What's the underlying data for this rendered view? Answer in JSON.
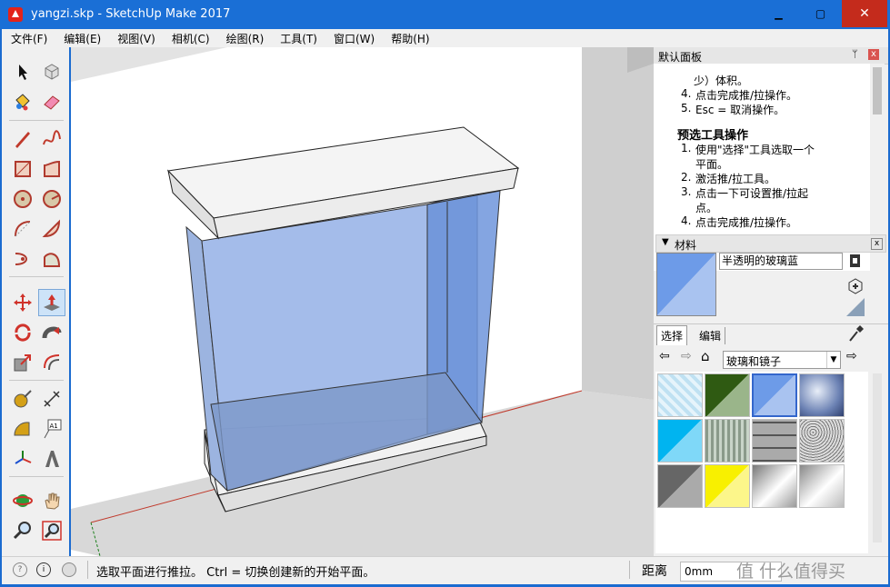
{
  "window": {
    "title": "yangzi.skp - SketchUp Make 2017",
    "min_glyph": "▁",
    "max_glyph": "▢",
    "close_glyph": "✕"
  },
  "menu": [
    "文件(F)",
    "编辑(E)",
    "视图(V)",
    "相机(C)",
    "绘图(R)",
    "工具(T)",
    "窗口(W)",
    "帮助(H)"
  ],
  "tools": [
    "select-icon",
    "component-icon",
    "paint-bucket-icon",
    "eraser-icon",
    "pencil-icon",
    "freehand-icon",
    "rectangle-icon",
    "rotated-rectangle-icon",
    "circle-icon",
    "polygon-icon",
    "arc-icon",
    "pie-icon",
    "arc3-icon",
    "arc-2pt-icon",
    "move-icon",
    "push-pull-icon",
    "rotate-icon",
    "follow-me-icon",
    "scale-icon",
    "offset-icon",
    "tape-measure-icon",
    "dimension-icon",
    "protractor-icon",
    "text-icon",
    "axes-icon",
    "3d-text-icon",
    "orbit-icon",
    "pan-icon",
    "zoom-icon",
    "zoom-extents-icon"
  ],
  "tray": {
    "title": "默认面板",
    "pin_glyph": "ᛘ",
    "close_glyph": "x",
    "help": {
      "lines_top": [
        "少）体积。"
      ],
      "list1": [
        {
          "num": "4.",
          "text": "点击完成推/拉操作。"
        },
        {
          "num": "5.",
          "text": "Esc = 取消操作。"
        }
      ],
      "heading": "预选工具操作",
      "list2": [
        {
          "num": "1.",
          "text": "使用\"选择\"工具选取一个"
        },
        {
          "num": "",
          "text": "平面。"
        },
        {
          "num": "2.",
          "text": "激活推/拉工具。"
        },
        {
          "num": "3.",
          "text": "点击一下可设置推/拉起"
        },
        {
          "num": "",
          "text": "点。"
        },
        {
          "num": "4.",
          "text": "点击完成推/拉操作。"
        }
      ]
    },
    "materials": {
      "header": "材料",
      "name_value": "半透明的玻璃蓝",
      "tab_select": "选择",
      "tab_edit": "编辑",
      "library": "玻璃和镜子",
      "colors": {
        "current": "#6d9be8",
        "current_light": "#a9c3f0"
      }
    }
  },
  "status": {
    "message": "选取平面进行推拉。 Ctrl = 切换创建新的开始平面。",
    "distance_label": "距离",
    "distance_value": "0mm",
    "watermark": "值 什么值得买"
  }
}
